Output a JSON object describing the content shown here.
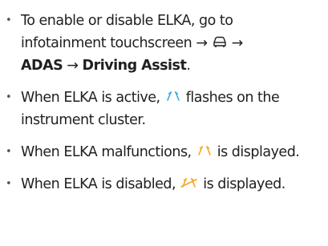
{
  "bullets": [
    {
      "text_before": "To enable or disable ELKA, go to infotainment touchscreen ",
      "arrow1": "→",
      "arrow2": "→",
      "adas": "ADAS",
      "arrow3": "→",
      "driving_assist": "Driving Assist",
      "end": "."
    },
    {
      "text_before": "When ELKA is active, ",
      "text_after": " flashes on the instrument cluster."
    },
    {
      "text_before": "When ELKA malfunctions, ",
      "text_after": " is displayed."
    },
    {
      "text_before": "When ELKA is disabled, ",
      "text_after": " is displayed."
    }
  ],
  "icons": {
    "car": "car-icon",
    "lane_active": "lane-keep-active-icon",
    "lane_malfunction": "lane-keep-malfunction-icon",
    "lane_disabled": "lane-keep-disabled-icon"
  },
  "colors": {
    "text": "#1f1f1f",
    "lane_active": "#3aa7e6",
    "lane_malfunction": "#f5a623",
    "lane_disabled": "#f5a623"
  }
}
